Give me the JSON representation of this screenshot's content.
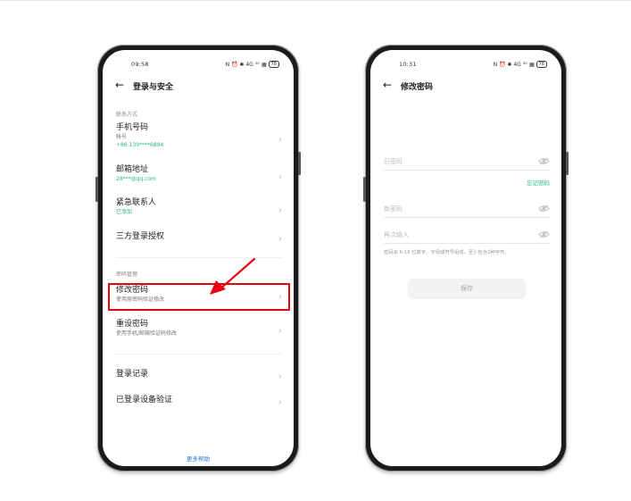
{
  "left_phone": {
    "status_time": "09:58",
    "status_icons_text": "N ⏰ ✱ 4G ⁵ᴳ ▦",
    "battery": "78",
    "title": "登录与安全",
    "section_contact": "联系方式",
    "items": [
      {
        "title": "手机号码",
        "sub": "帐号",
        "value": "+86 139****6894"
      },
      {
        "title": "邮箱地址",
        "value": "28***@qq.com"
      },
      {
        "title": "紧急联系人",
        "value": "已添加"
      },
      {
        "title": "三方登录授权"
      }
    ],
    "section_password": "密码管理",
    "password_items": [
      {
        "title": "修改密码",
        "sub": "使用原密码验证修改"
      },
      {
        "title": "重设密码",
        "sub": "使用手机/邮箱验证码修改"
      }
    ],
    "login_items": [
      {
        "title": "登录记录"
      },
      {
        "title": "已登录设备验证"
      }
    ],
    "more_help": "更多帮助"
  },
  "right_phone": {
    "status_time": "10:31",
    "status_icons_text": "N ⏰ ✱ 4G ⁵ᴳ ▦",
    "battery": "78",
    "title": "修改密码",
    "old_password_placeholder": "旧密码",
    "forgot_password": "忘记密码",
    "new_password_placeholder": "新密码",
    "confirm_placeholder": "再次输入",
    "hint": "密码由 6-16 位数字、字母或符号组成，至少包含2种字符。",
    "save_label": "保存"
  },
  "colors": {
    "accent_green": "#2bb87c",
    "link_blue": "#2a78e4",
    "highlight_red": "#e60012"
  }
}
